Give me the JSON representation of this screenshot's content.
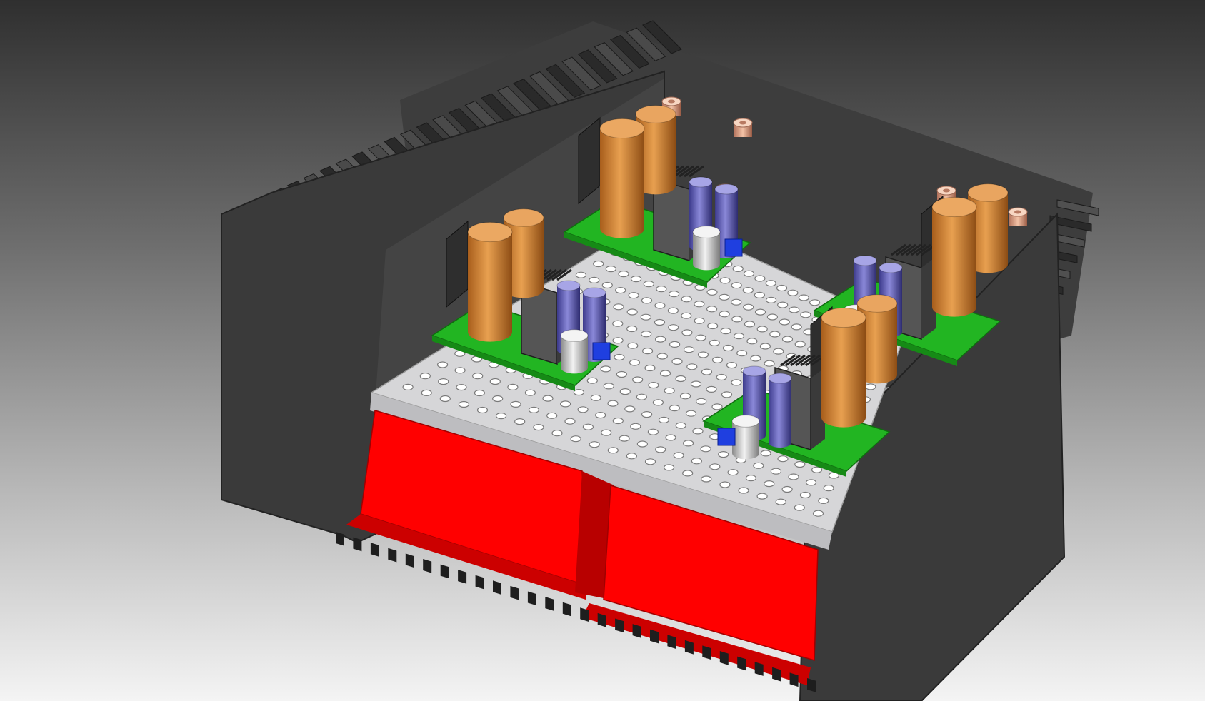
{
  "viewport": {
    "background_top": "#2f2f2f",
    "background_bottom": "#f4f4f4"
  },
  "model": {
    "chassis_color": "#3b3b3b",
    "heatsink_fin_color": "#2a2a2a",
    "transformer_color": "#ff0000",
    "perforated_plate_color": "#d9d9da",
    "pcb_color": "#22b522",
    "large_capacitor_color": "#d0802e",
    "small_capacitor_color": "#6a68b8",
    "film_capacitor_color": "#1f3fe0",
    "standoff_color": "#e0a080",
    "amplifier_modules": 4,
    "transformers": 2
  }
}
